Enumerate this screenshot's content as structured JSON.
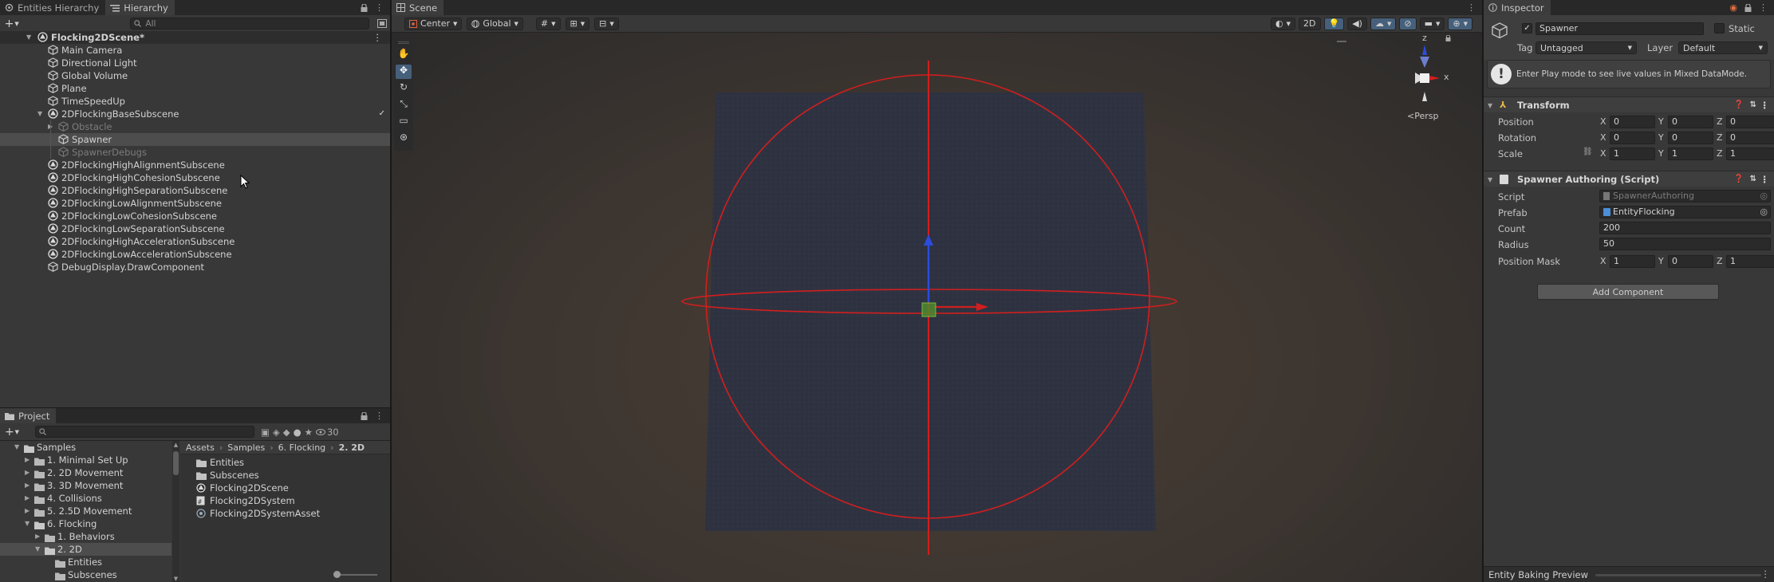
{
  "hierarchy": {
    "tabs": [
      "Entities Hierarchy",
      "Hierarchy"
    ],
    "search_placeholder": "All",
    "scene": "Flocking2DScene*",
    "items": [
      {
        "label": "Main Camera",
        "depth": 1,
        "icon": "cube-icon"
      },
      {
        "label": "Directional Light",
        "depth": 1,
        "icon": "cube-icon"
      },
      {
        "label": "Global Volume",
        "depth": 1,
        "icon": "cube-icon"
      },
      {
        "label": "Plane",
        "depth": 1,
        "icon": "cube-icon"
      },
      {
        "label": "TimeSpeedUp",
        "depth": 1,
        "icon": "cube-icon"
      },
      {
        "label": "2DFlockingBaseSubscene",
        "depth": 1,
        "icon": "subscene-icon",
        "expanded": true,
        "checked": true
      },
      {
        "label": "Obstacle",
        "depth": 2,
        "icon": "cube-icon",
        "muted": true,
        "collapsed": true
      },
      {
        "label": "Spawner",
        "depth": 2,
        "icon": "cube-icon",
        "selected": true
      },
      {
        "label": "SpawnerDebugs",
        "depth": 2,
        "icon": "cube-icon",
        "muted": true
      },
      {
        "label": "2DFlockingHighAlignmentSubscene",
        "depth": 1,
        "icon": "subscene-icon"
      },
      {
        "label": "2DFlockingHighCohesionSubscene",
        "depth": 1,
        "icon": "subscene-icon"
      },
      {
        "label": "2DFlockingHighSeparationSubscene",
        "depth": 1,
        "icon": "subscene-icon"
      },
      {
        "label": "2DFlockingLowAlignmentSubscene",
        "depth": 1,
        "icon": "subscene-icon"
      },
      {
        "label": "2DFlockingLowCohesionSubscene",
        "depth": 1,
        "icon": "subscene-icon"
      },
      {
        "label": "2DFlockingLowSeparationSubscene",
        "depth": 1,
        "icon": "subscene-icon"
      },
      {
        "label": "2DFlockingHighAccelerationSubscene",
        "depth": 1,
        "icon": "subscene-icon"
      },
      {
        "label": "2DFlockingLowAccelerationSubscene",
        "depth": 1,
        "icon": "subscene-icon"
      },
      {
        "label": "DebugDisplay.DrawComponent",
        "depth": 1,
        "icon": "cube-icon"
      }
    ]
  },
  "project": {
    "tab": "Project",
    "count": "30",
    "tree": [
      {
        "label": "Samples",
        "depth": 0,
        "open": true
      },
      {
        "label": "1. Minimal Set Up",
        "depth": 1
      },
      {
        "label": "2. 2D Movement",
        "depth": 1
      },
      {
        "label": "3. 3D Movement",
        "depth": 1
      },
      {
        "label": "4. Collisions",
        "depth": 1
      },
      {
        "label": "5. 2.5D Movement",
        "depth": 1
      },
      {
        "label": "6. Flocking",
        "depth": 1,
        "open": true
      },
      {
        "label": "1. Behaviors",
        "depth": 2
      },
      {
        "label": "2. 2D",
        "depth": 2,
        "open": true,
        "selected": true
      },
      {
        "label": "Entities",
        "depth": 3
      },
      {
        "label": "Subscenes",
        "depth": 3
      }
    ],
    "breadcrumb": [
      "Assets",
      "Samples",
      "6. Flocking",
      "2. 2D"
    ],
    "files": [
      {
        "label": "Entities",
        "icon": "folder-icon"
      },
      {
        "label": "Subscenes",
        "icon": "folder-icon"
      },
      {
        "label": "Flocking2DScene",
        "icon": "unity-scene-icon"
      },
      {
        "label": "Flocking2DSystem",
        "icon": "script-icon"
      },
      {
        "label": "Flocking2DSystemAsset",
        "icon": "asset-icon"
      }
    ]
  },
  "scene": {
    "tab": "Scene",
    "pivot": "Center",
    "space": "Global",
    "mode_2d": "2D",
    "persp_label": "Persp",
    "gizmo_labels": {
      "x": "x",
      "z": "z"
    }
  },
  "inspector": {
    "tab": "Inspector",
    "object_name": "Spawner",
    "static_label": "Static",
    "tag_label": "Tag",
    "tag_value": "Untagged",
    "layer_label": "Layer",
    "layer_value": "Default",
    "info": "Enter Play mode to see live values in Mixed DataMode.",
    "transform": {
      "title": "Transform",
      "position": {
        "label": "Position",
        "x": "0",
        "y": "0",
        "z": "0"
      },
      "rotation": {
        "label": "Rotation",
        "x": "0",
        "y": "0",
        "z": "0"
      },
      "scale": {
        "label": "Scale",
        "x": "1",
        "y": "1",
        "z": "1"
      }
    },
    "spawner": {
      "title": "Spawner Authoring (Script)",
      "script_label": "Script",
      "script_value": "SpawnerAuthoring",
      "prefab_label": "Prefab",
      "prefab_value": "EntityFlocking",
      "count_label": "Count",
      "count_value": "200",
      "radius_label": "Radius",
      "radius_value": "50",
      "mask_label": "Position Mask",
      "mask": {
        "x": "1",
        "y": "0",
        "z": "1"
      }
    },
    "add_component": "Add Component",
    "baking_preview": "Entity Baking Preview"
  },
  "axis_letters": {
    "x": "X",
    "y": "Y",
    "z": "Z"
  },
  "colors": {
    "accent_blue": "#46607c",
    "gizmo_red": "#d21e1e",
    "gizmo_blue": "#2b4cdc",
    "gizmo_green": "#5aa02c"
  }
}
